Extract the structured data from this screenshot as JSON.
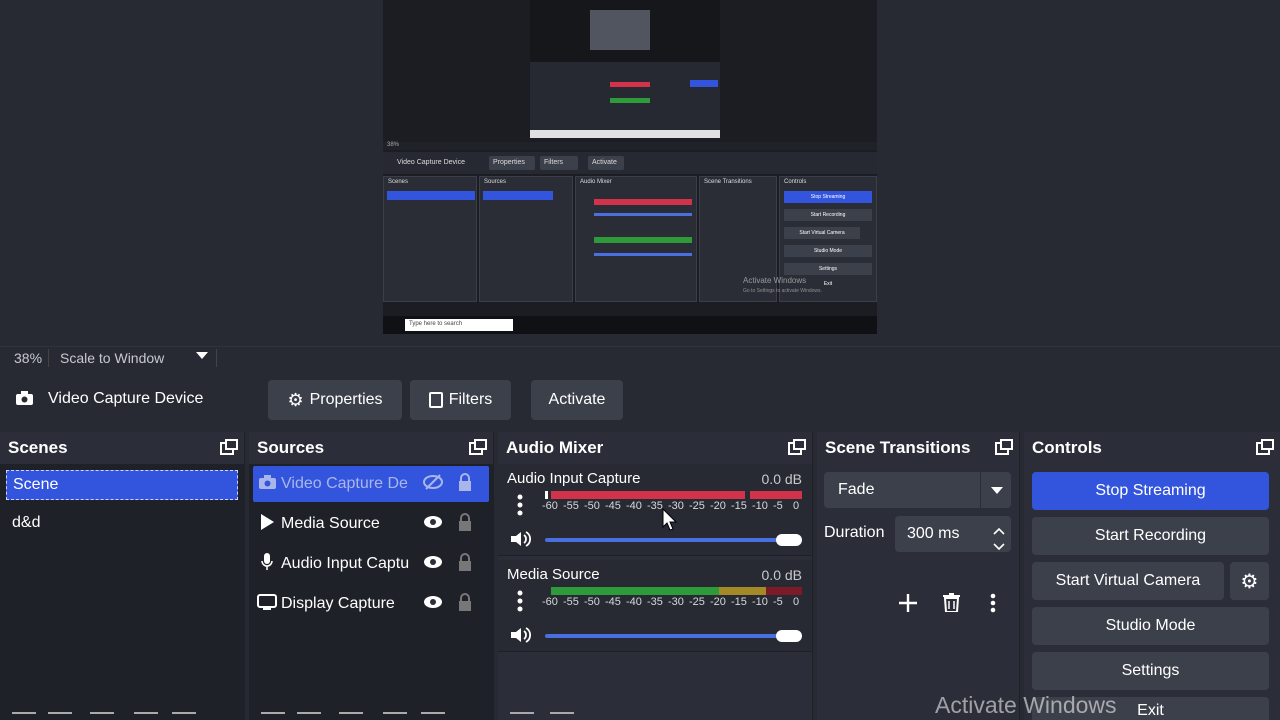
{
  "preview": {
    "mini": {
      "zoom": "38%",
      "source": "Video Capture Device",
      "properties": "Properties",
      "filters": "Filters",
      "activate": "Activate",
      "scenes": "Scenes",
      "sources": "Sources",
      "audio_mixer": "Audio Mixer",
      "scene_transitions": "Scene Transitions",
      "controls": "Controls",
      "stop_streaming": "Stop Streaming",
      "start_recording": "Start Recording",
      "start_virtual_camera": "Start Virtual Camera",
      "studio_mode": "Studio Mode",
      "settings": "Settings",
      "exit": "Exit",
      "watermark": "Activate Windows",
      "watermark_sub": "Go to Settings to activate Windows.",
      "search": "Type here to search"
    }
  },
  "zoom": {
    "percent": "38%",
    "mode": "Scale to Window"
  },
  "source_toolbar": {
    "source_name": "Video Capture Device",
    "properties": "Properties",
    "filters": "Filters",
    "activate": "Activate"
  },
  "scenes": {
    "title": "Scenes",
    "items": [
      "Scene",
      "d&d"
    ],
    "selected_index": 0
  },
  "sources": {
    "title": "Sources",
    "items": [
      {
        "label": "Video Capture De",
        "icon": "camera-icon",
        "visible": false,
        "selected": true
      },
      {
        "label": "Media Source",
        "icon": "play-icon",
        "visible": true,
        "selected": false
      },
      {
        "label": "Audio Input Captu",
        "icon": "microphone-icon",
        "visible": true,
        "selected": false
      },
      {
        "label": "Display Capture",
        "icon": "monitor-icon",
        "visible": true,
        "selected": false
      }
    ]
  },
  "audio_mixer": {
    "title": "Audio Mixer",
    "channels": [
      {
        "name": "Audio Input Capture",
        "db": "0.0 dB",
        "volume": 1.0
      },
      {
        "name": "Media Source",
        "db": "0.0 dB",
        "volume": 1.0
      }
    ],
    "ticks": [
      "-60",
      "-55",
      "-50",
      "-45",
      "-40",
      "-35",
      "-30",
      "-25",
      "-20",
      "-15",
      "-10",
      "-5",
      "0"
    ]
  },
  "scene_transitions": {
    "title": "Scene Transitions",
    "transition": "Fade",
    "duration_label": "Duration",
    "duration_value": "300 ms"
  },
  "controls": {
    "title": "Controls",
    "stop_streaming": "Stop Streaming",
    "start_recording": "Start Recording",
    "start_virtual_camera": "Start Virtual Camera",
    "studio_mode": "Studio Mode",
    "settings": "Settings",
    "exit": "Exit"
  },
  "watermark": "Activate Windows",
  "colors": {
    "accent": "#3355dd",
    "meter_red": "#d2334a",
    "meter_green": "#2f9a3a",
    "meter_yellow": "#a38a26",
    "meter_darkred": "#7c1a28",
    "slider": "#4a6fe0"
  }
}
